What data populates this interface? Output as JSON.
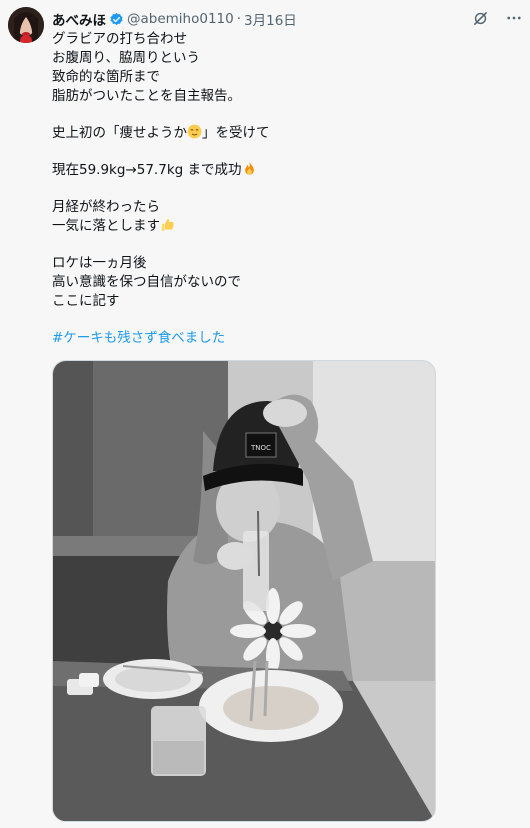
{
  "user": {
    "display_name": "あべみほ",
    "handle": "@abemiho0110",
    "separator": "·",
    "date": "3月16日"
  },
  "tweet": {
    "lines": [
      "グラビアの打ち合わせ",
      "お腹周り、脇周りという",
      "致命的な箇所まで",
      "脂肪がついたことを自主報告。",
      "",
      "史上初の「痩せようか",
      "",
      "現在59.9kg→57.7kg まで成功",
      "",
      "月経が終わったら",
      "一気に落とします",
      "",
      "ロケは一ヵ月後",
      "高い意識を保つ自信がないので",
      "ここに記す"
    ],
    "line6_suffix": "」を受けて",
    "hashtag": "#ケーキも残さず食べました"
  },
  "photo_cap_text": "TNOC",
  "icons": {
    "verified": "verified-badge-icon",
    "grok": "grok-icon",
    "more": "more-icon",
    "smile": "relieved-face-emoji",
    "fire": "fire-emoji",
    "thumbs": "thumbs-up-emoji"
  },
  "colors": {
    "accent": "#1d9bf0",
    "text": "#0f1419",
    "secondary": "#536471"
  }
}
